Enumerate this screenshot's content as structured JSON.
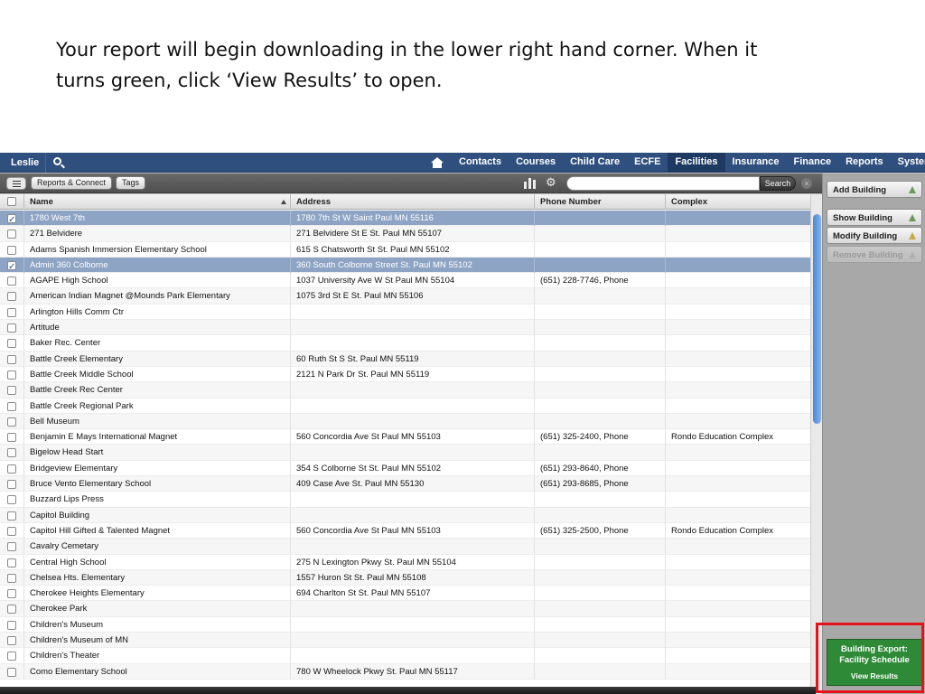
{
  "caption": {
    "line1": "Your report will begin downloading in the lower right hand corner. When it",
    "line2": "turns green, click ‘View Results’ to open."
  },
  "navbar": {
    "user": "Leslie",
    "tabs": [
      "Contacts",
      "Courses",
      "Child Care",
      "ECFE",
      "Facilities",
      "Insurance",
      "Finance",
      "Reports",
      "System"
    ],
    "active_tab": "Facilities"
  },
  "toolbar": {
    "reports_connect": "Reports & Connect",
    "tags": "Tags",
    "search_value": "",
    "search_button": "Search"
  },
  "grid": {
    "headers": {
      "name": "Name",
      "address": "Address",
      "phone": "Phone Number",
      "complex": "Complex"
    },
    "rows": [
      {
        "name": "1780 West 7th",
        "address": "1780 7th St W Saint Paul MN 55116",
        "phone": "",
        "complex": "",
        "checked": true
      },
      {
        "name": "271 Belvidere",
        "address": "271 Belvidere St E St. Paul MN 55107",
        "phone": "",
        "complex": "",
        "checked": false
      },
      {
        "name": "Adams Spanish Immersion Elementary School",
        "address": "615 S Chatsworth St St. Paul MN 55102",
        "phone": "",
        "complex": "",
        "checked": false
      },
      {
        "name": "Admin 360 Colborne",
        "address": "360 South Colborne Street St. Paul MN 55102",
        "phone": "",
        "complex": "",
        "checked": true
      },
      {
        "name": "AGAPE High School",
        "address": "1037 University Ave W St Paul MN 55104",
        "phone": "(651) 228-7746, Phone",
        "complex": "",
        "checked": false
      },
      {
        "name": "American Indian Magnet @Mounds Park Elementary",
        "address": "1075 3rd St E St. Paul MN 55106",
        "phone": "",
        "complex": "",
        "checked": false
      },
      {
        "name": "Arlington Hills Comm Ctr",
        "address": "",
        "phone": "",
        "complex": "",
        "checked": false
      },
      {
        "name": "Artitude",
        "address": "",
        "phone": "",
        "complex": "",
        "checked": false
      },
      {
        "name": "Baker Rec. Center",
        "address": "",
        "phone": "",
        "complex": "",
        "checked": false
      },
      {
        "name": "Battle Creek Elementary",
        "address": "60 Ruth St S St. Paul MN 55119",
        "phone": "",
        "complex": "",
        "checked": false
      },
      {
        "name": "Battle Creek Middle School",
        "address": "2121 N Park Dr St. Paul MN 55119",
        "phone": "",
        "complex": "",
        "checked": false
      },
      {
        "name": "Battle Creek Rec Center",
        "address": "",
        "phone": "",
        "complex": "",
        "checked": false
      },
      {
        "name": "Battle Creek Regional Park",
        "address": "",
        "phone": "",
        "complex": "",
        "checked": false
      },
      {
        "name": "Bell Museum",
        "address": "",
        "phone": "",
        "complex": "",
        "checked": false
      },
      {
        "name": "Benjamin E Mays International Magnet",
        "address": "560 Concordia Ave St Paul MN 55103",
        "phone": "(651) 325-2400, Phone",
        "complex": "Rondo Education Complex",
        "checked": false
      },
      {
        "name": "Bigelow Head Start",
        "address": "",
        "phone": "",
        "complex": "",
        "checked": false
      },
      {
        "name": "Bridgeview Elementary",
        "address": "354 S Colborne St St. Paul MN 55102",
        "phone": "(651) 293-8640, Phone",
        "complex": "",
        "checked": false
      },
      {
        "name": "Bruce Vento Elementary School",
        "address": "409 Case Ave St. Paul MN 55130",
        "phone": "(651) 293-8685, Phone",
        "complex": "",
        "checked": false
      },
      {
        "name": "Buzzard Lips Press",
        "address": "",
        "phone": "",
        "complex": "",
        "checked": false
      },
      {
        "name": "Capitol Building",
        "address": "",
        "phone": "",
        "complex": "",
        "checked": false
      },
      {
        "name": "Capitol Hill Gifted & Talented Magnet",
        "address": "560 Concordia Ave St Paul MN 55103",
        "phone": "(651) 325-2500, Phone",
        "complex": "Rondo Education Complex",
        "checked": false
      },
      {
        "name": "Cavalry Cemetary",
        "address": "",
        "phone": "",
        "complex": "",
        "checked": false
      },
      {
        "name": "Central High School",
        "address": "275 N Lexington Pkwy St. Paul MN 55104",
        "phone": "",
        "complex": "",
        "checked": false
      },
      {
        "name": "Chelsea Hts. Elementary",
        "address": "1557 Huron St St. Paul MN 55108",
        "phone": "",
        "complex": "",
        "checked": false
      },
      {
        "name": "Cherokee Heights Elementary",
        "address": "694 Charlton St St. Paul MN 55107",
        "phone": "",
        "complex": "",
        "checked": false
      },
      {
        "name": "Cherokee Park",
        "address": "",
        "phone": "",
        "complex": "",
        "checked": false
      },
      {
        "name": "Children's Museum",
        "address": "",
        "phone": "",
        "complex": "",
        "checked": false
      },
      {
        "name": "Children's Museum of MN",
        "address": "",
        "phone": "",
        "complex": "",
        "checked": false
      },
      {
        "name": "Children's Theater",
        "address": "",
        "phone": "",
        "complex": "",
        "checked": false
      },
      {
        "name": "Como Elementary School",
        "address": "780 W Wheelock Pkwy St. Paul MN 55117",
        "phone": "",
        "complex": "",
        "checked": false
      }
    ]
  },
  "sidepanel": {
    "add": "Add Building",
    "show": "Show Building",
    "modify": "Modify Building",
    "remove": "Remove Building"
  },
  "export": {
    "title_line1": "Building Export:",
    "title_line2": "Facility Schedule",
    "link": "View Results",
    "accent": "#2f8a37",
    "highlight": "#e8121b"
  }
}
